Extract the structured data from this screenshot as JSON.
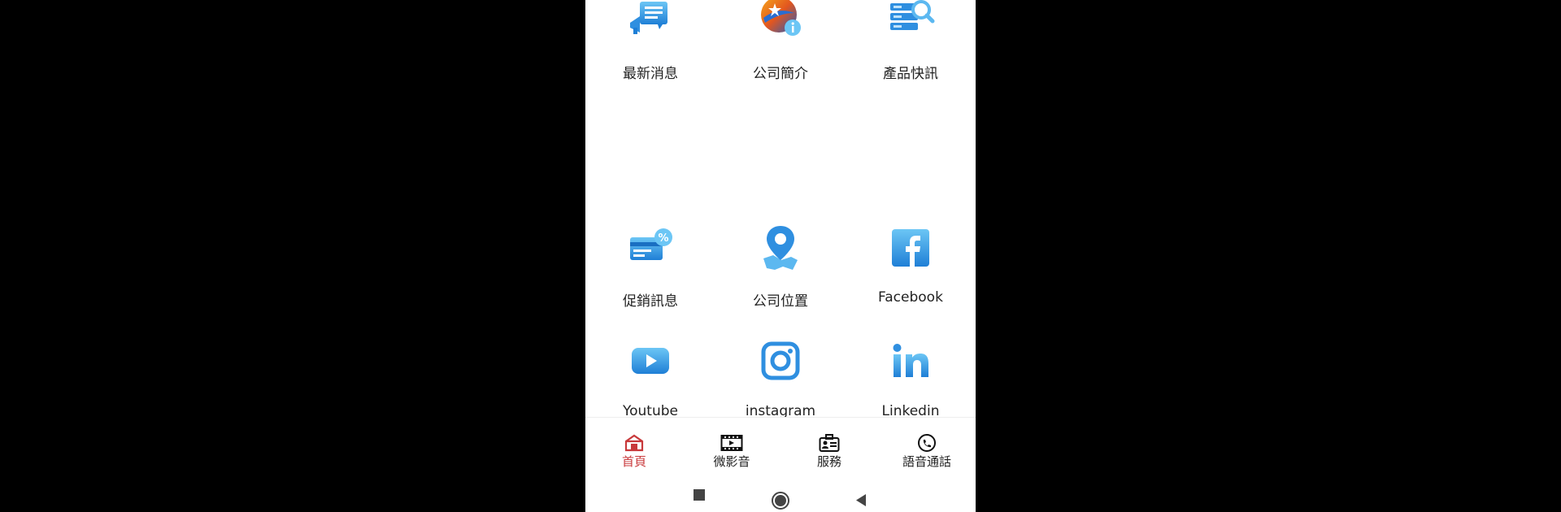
{
  "menu": {
    "items": [
      {
        "label": "最新消息",
        "icon": "news-megaphone-icon"
      },
      {
        "label": "公司簡介",
        "icon": "company-info-icon"
      },
      {
        "label": "產品快訊",
        "icon": "product-search-icon"
      },
      {
        "label": "促銷訊息",
        "icon": "promotion-card-icon"
      },
      {
        "label": "公司位置",
        "icon": "location-map-icon"
      },
      {
        "label": "Facebook",
        "icon": "facebook-icon"
      },
      {
        "label": "Youtube",
        "icon": "youtube-icon"
      },
      {
        "label": "instagram",
        "icon": "instagram-icon"
      },
      {
        "label": "Linkedin",
        "icon": "linkedin-icon"
      }
    ]
  },
  "tabbar": {
    "tabs": [
      {
        "label": "首頁",
        "icon": "home-icon",
        "active": true
      },
      {
        "label": "微影音",
        "icon": "video-icon",
        "active": false
      },
      {
        "label": "服務",
        "icon": "service-badge-icon",
        "active": false
      },
      {
        "label": "語音通話",
        "icon": "phone-call-icon",
        "active": false
      }
    ]
  },
  "colors": {
    "accent": "#c8393b",
    "icon_blue": "#2f8fe0",
    "icon_light_blue": "#5cb8f0"
  },
  "system_nav": {
    "buttons": [
      "recents-square-icon",
      "home-circle-icon",
      "back-triangle-icon"
    ]
  }
}
